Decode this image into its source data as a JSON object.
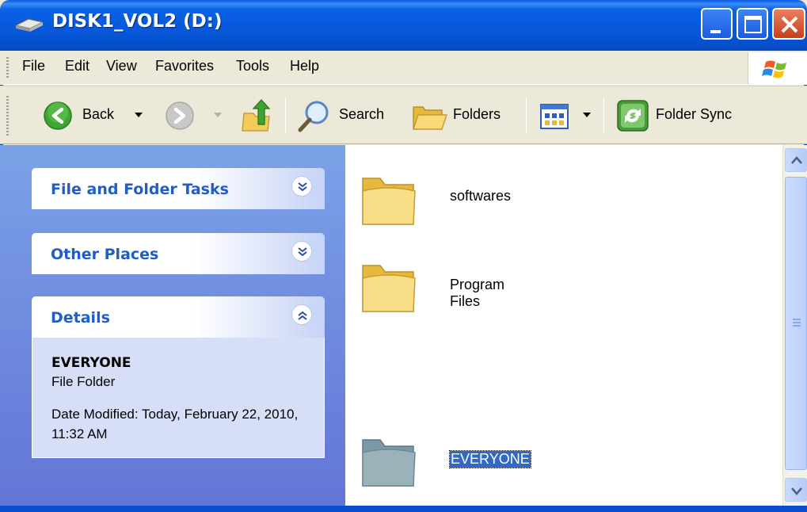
{
  "window": {
    "title": "DISK1_VOL2 (D:)",
    "accent_color": "#0A5AE0"
  },
  "menu": {
    "items": [
      "File",
      "Edit",
      "View",
      "Favorites",
      "Tools",
      "Help"
    ]
  },
  "toolbar": {
    "back_label": "Back",
    "search_label": "Search",
    "folders_label": "Folders",
    "folder_sync_label": "Folder Sync"
  },
  "taskpane": {
    "panels": [
      {
        "title": "File and Folder Tasks",
        "state": "collapsed"
      },
      {
        "title": "Other Places",
        "state": "collapsed"
      },
      {
        "title": "Details",
        "state": "expanded"
      }
    ],
    "details": {
      "name": "EVERYONE",
      "type": "File Folder",
      "date_modified": "Date Modified: Today, February 22, 2010, 11:32 AM"
    }
  },
  "files": [
    {
      "name": "softwares",
      "selected": false
    },
    {
      "name": "Program Files",
      "selected": false
    },
    {
      "name": "EVERYONE",
      "selected": true
    }
  ]
}
